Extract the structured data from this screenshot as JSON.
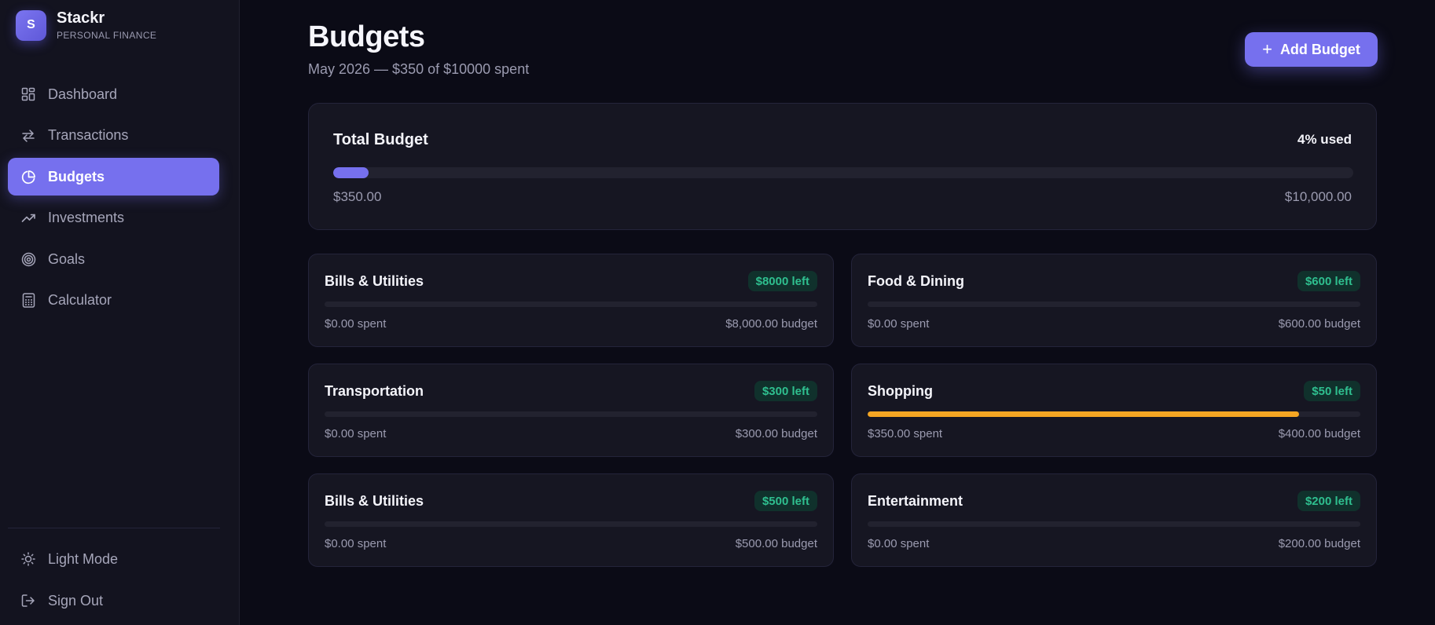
{
  "brand": {
    "logo_letter": "S",
    "name": "Stackr",
    "subtitle": "PERSONAL FINANCE",
    "accent": "#7670ee"
  },
  "nav": {
    "items": [
      {
        "label": "Dashboard",
        "icon": "dashboard-grid-icon",
        "active": false
      },
      {
        "label": "Transactions",
        "icon": "arrows-swap-icon",
        "active": false
      },
      {
        "label": "Budgets",
        "icon": "pie-chart-icon",
        "active": true
      },
      {
        "label": "Investments",
        "icon": "trending-up-icon",
        "active": false
      },
      {
        "label": "Goals",
        "icon": "target-icon",
        "active": false
      },
      {
        "label": "Calculator",
        "icon": "calculator-icon",
        "active": false
      }
    ],
    "bottom": [
      {
        "label": "Light Mode",
        "icon": "sun-icon"
      },
      {
        "label": "Sign Out",
        "icon": "sign-out-icon"
      }
    ]
  },
  "header": {
    "title": "Budgets",
    "subtitle": "May 2026 — $350 of $10000 spent",
    "add_button": "Add Budget"
  },
  "total": {
    "title": "Total Budget",
    "used_label": "4% used",
    "used_fraction": 0.035,
    "spent": "$350.00",
    "budget": "$10,000.00"
  },
  "budgets": [
    {
      "name": "Bills & Utilities",
      "left": "$8000 left",
      "spent": "$0.00 spent",
      "budget": "$8,000.00 budget",
      "progress": 0,
      "bar_color": "#7670ee"
    },
    {
      "name": "Food & Dining",
      "left": "$600 left",
      "spent": "$0.00 spent",
      "budget": "$600.00 budget",
      "progress": 0,
      "bar_color": "#7670ee"
    },
    {
      "name": "Transportation",
      "left": "$300 left",
      "spent": "$0.00 spent",
      "budget": "$300.00 budget",
      "progress": 0,
      "bar_color": "#7670ee"
    },
    {
      "name": "Shopping",
      "left": "$50 left",
      "spent": "$350.00 spent",
      "budget": "$400.00 budget",
      "progress": 0.875,
      "bar_color": "#f5a623"
    },
    {
      "name": "Bills & Utilities",
      "left": "$500 left",
      "spent": "$0.00 spent",
      "budget": "$500.00 budget",
      "progress": 0,
      "bar_color": "#7670ee"
    },
    {
      "name": "Entertainment",
      "left": "$200 left",
      "spent": "$0.00 spent",
      "budget": "$200.00 budget",
      "progress": 0,
      "bar_color": "#7670ee"
    }
  ]
}
